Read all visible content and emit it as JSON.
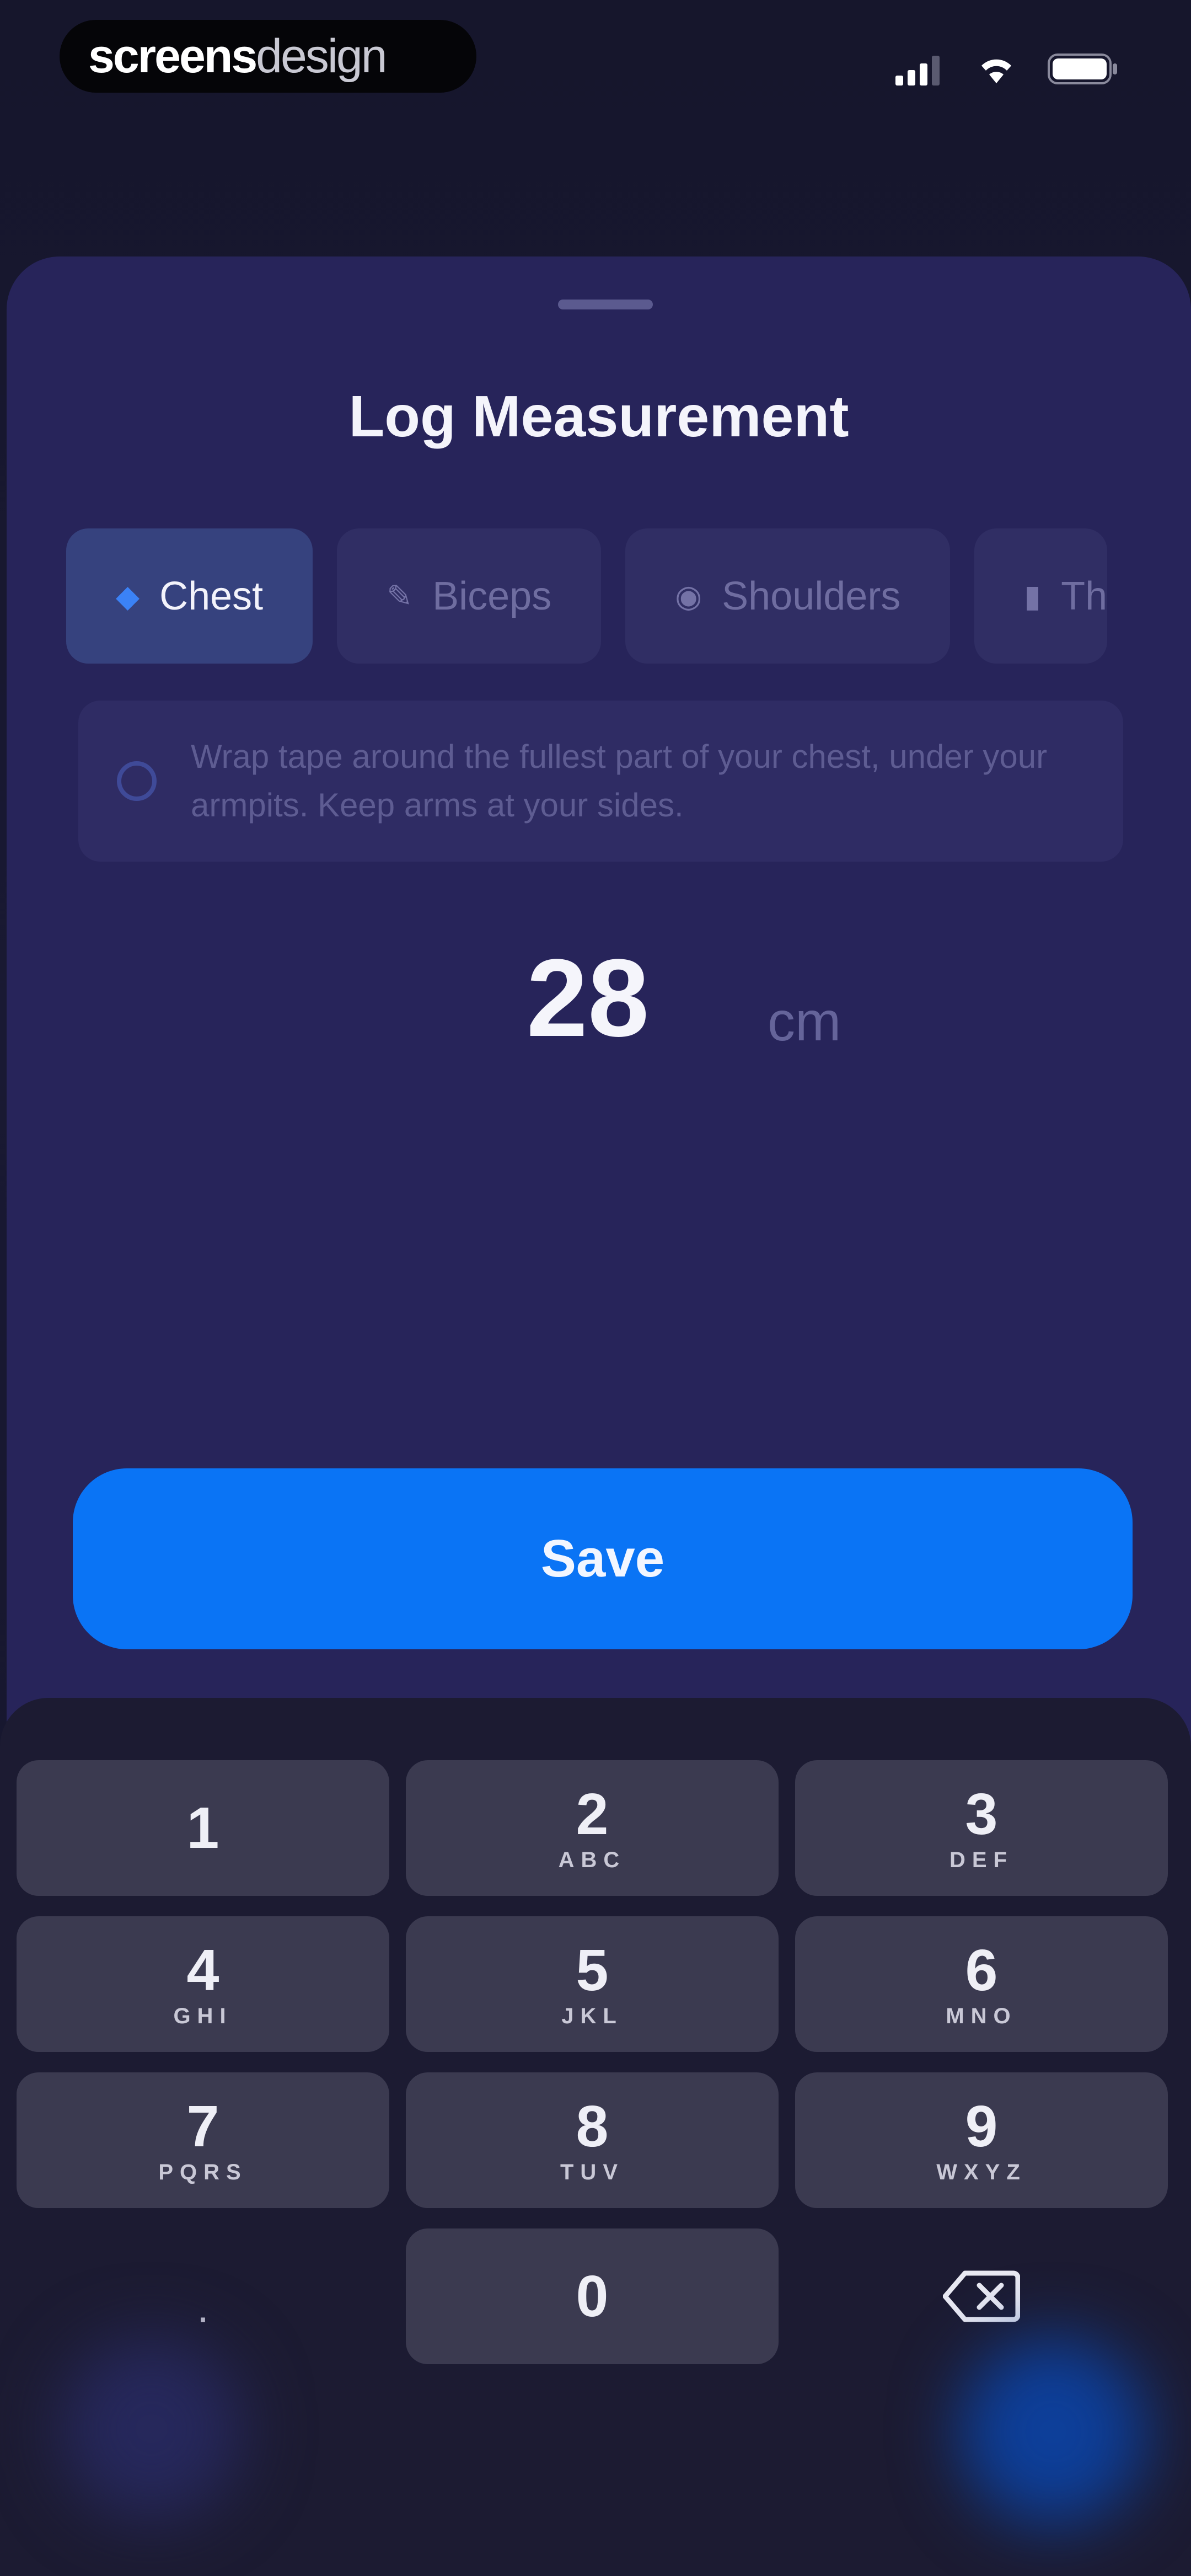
{
  "status_bar": {
    "brand_bold": "screens",
    "brand_light": "design"
  },
  "sheet": {
    "title": "Log Measurement",
    "tabs": [
      {
        "label": "Chest",
        "icon": "chest-icon",
        "active": true
      },
      {
        "label": "Biceps",
        "icon": "bicep-icon",
        "active": false
      },
      {
        "label": "Shoulders",
        "icon": "shoulder-icon",
        "active": false
      },
      {
        "label": "Th",
        "icon": "thigh-icon",
        "active": false
      }
    ],
    "instruction": "Wrap tape around the fullest part of your chest, under your armpits. Keep arms at your sides.",
    "value": "28",
    "unit": "cm",
    "save_label": "Save"
  },
  "keyboard": {
    "keys": [
      {
        "num": "1",
        "sub": ""
      },
      {
        "num": "2",
        "sub": "ABC"
      },
      {
        "num": "3",
        "sub": "DEF"
      },
      {
        "num": "4",
        "sub": "GHI"
      },
      {
        "num": "5",
        "sub": "JKL"
      },
      {
        "num": "6",
        "sub": "MNO"
      },
      {
        "num": "7",
        "sub": "PQRS"
      },
      {
        "num": "8",
        "sub": "TUV"
      },
      {
        "num": "9",
        "sub": "WXYZ"
      },
      {
        "num": "0",
        "sub": ""
      }
    ],
    "decimal": ".",
    "delete_icon": "backspace-icon"
  },
  "colors": {
    "accent": "#0a74f5",
    "sheet": "#27245a",
    "keyboard": "#1c1b32",
    "key": "#3b3a50"
  }
}
